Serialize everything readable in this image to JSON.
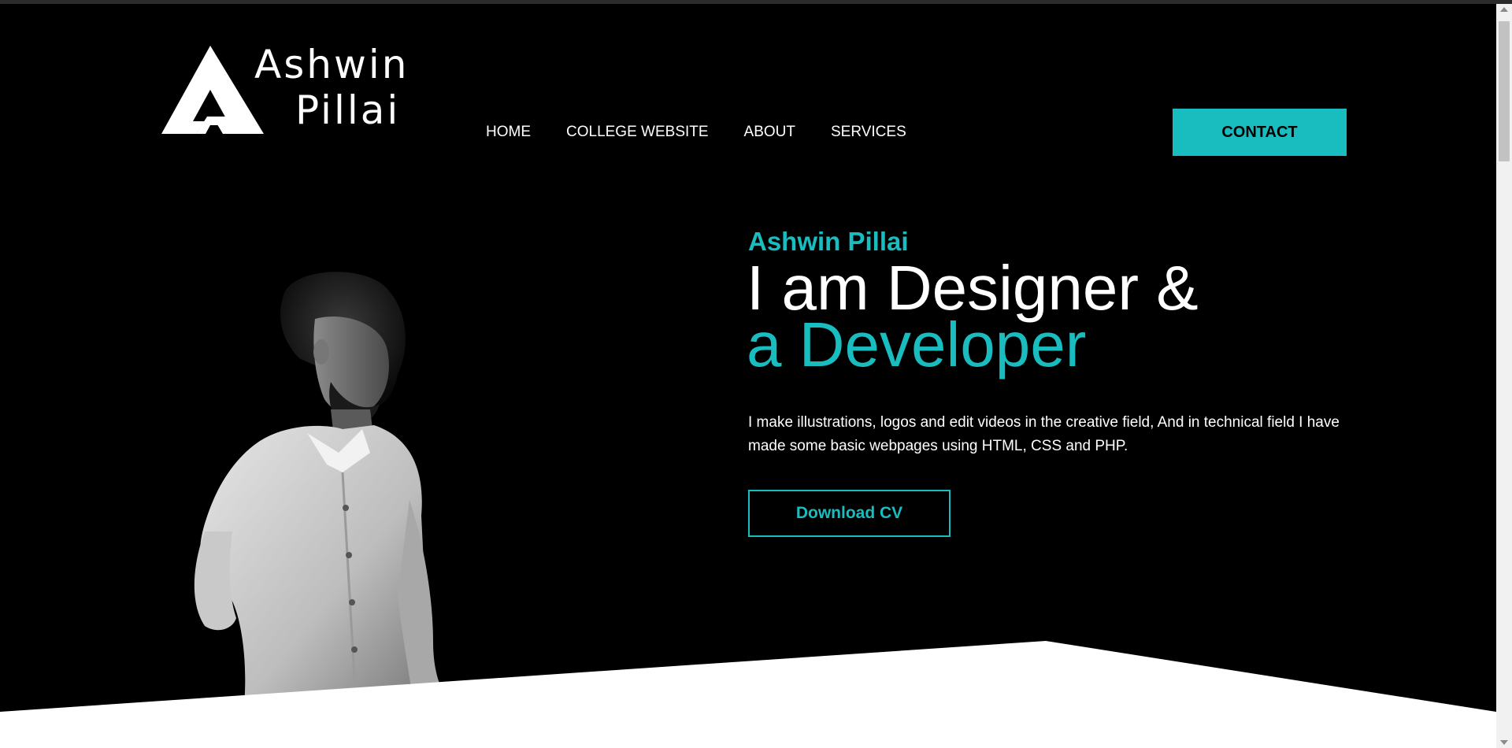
{
  "logo": {
    "line1": "Ashwin",
    "line2": "Pillai"
  },
  "nav": {
    "items": [
      {
        "label": "HOME"
      },
      {
        "label": "COLLEGE WEBSITE"
      },
      {
        "label": "ABOUT"
      },
      {
        "label": "SERVICES"
      }
    ],
    "contact_label": "CONTACT"
  },
  "hero": {
    "name": "Ashwin Pillai",
    "headline_line1": "I am Designer &",
    "headline_line2": "a Developer",
    "description": "I make illustrations, logos and edit videos in the creative field, And in technical field I have made some basic webpages using HTML, CSS and PHP.",
    "cta_label": "Download CV"
  },
  "colors": {
    "accent": "#19bcbf",
    "background": "#000000",
    "text": "#ffffff"
  },
  "icons": {
    "logo_mark": "a-triangle-logo-icon",
    "scroll_up": "chevron-up-icon",
    "scroll_down": "chevron-down-icon"
  }
}
